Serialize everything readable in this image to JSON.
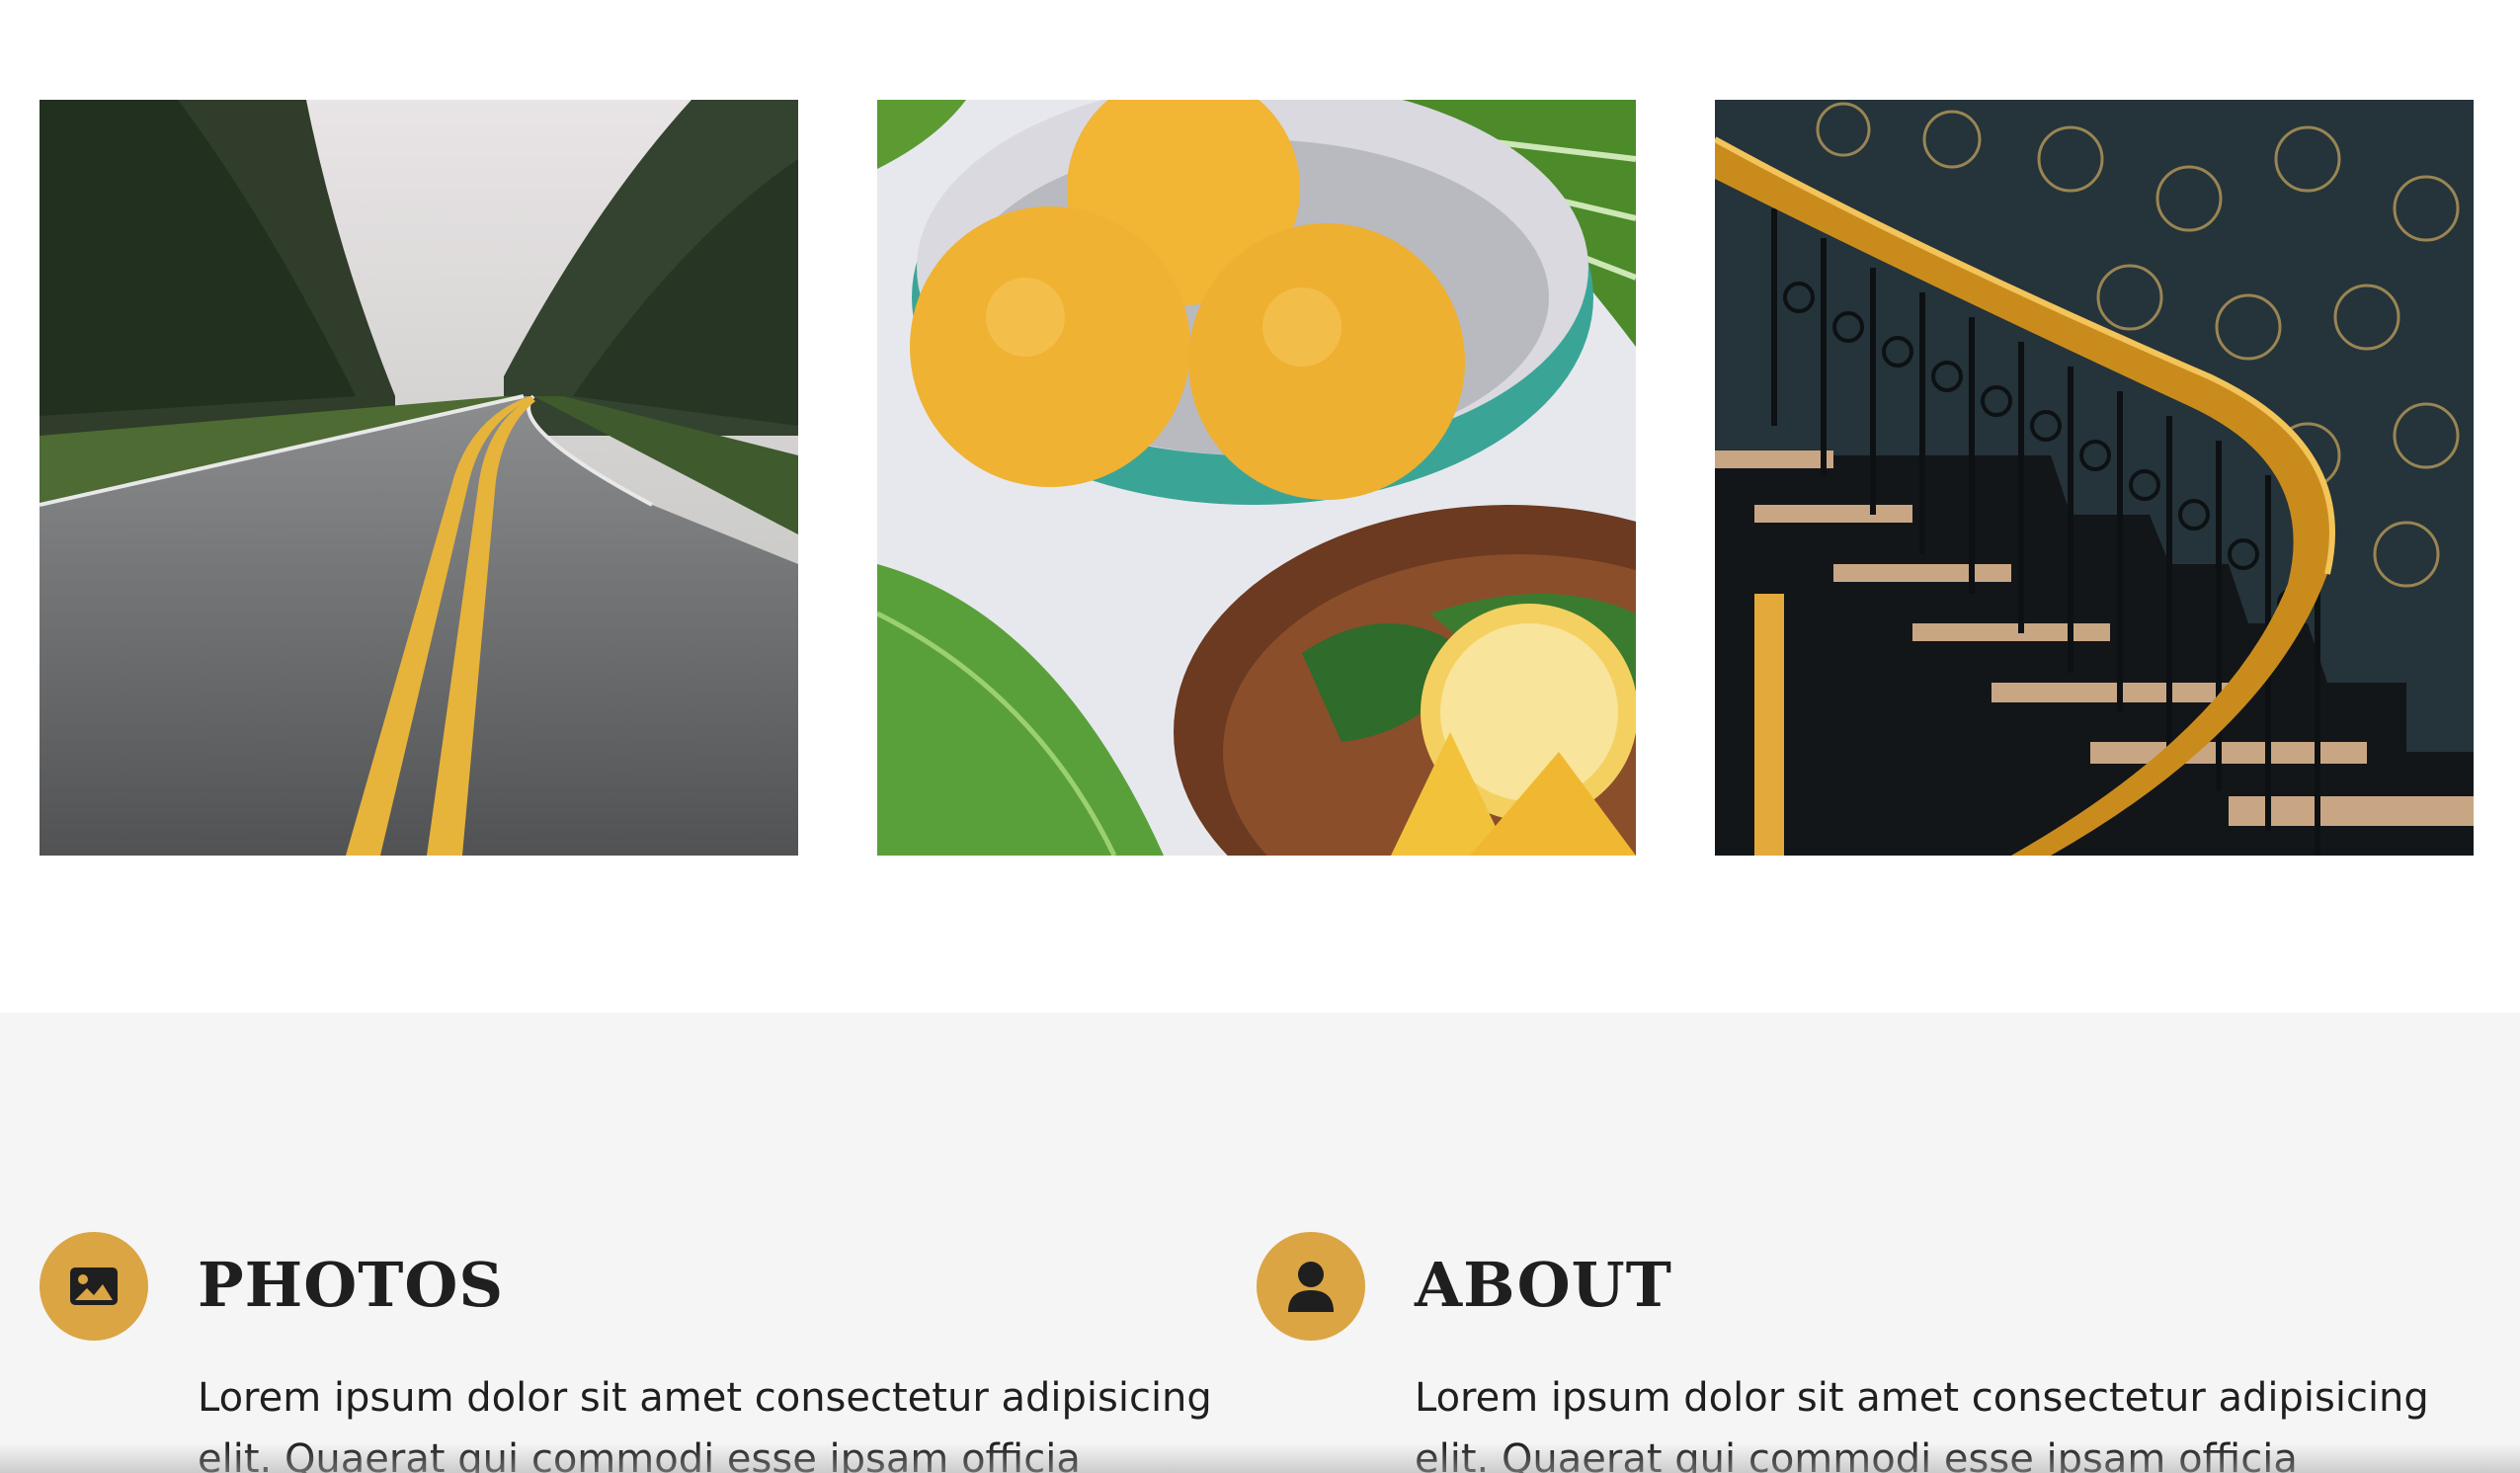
{
  "gallery": {
    "images": [
      {
        "subject": "foggy forest road with yellow center lines"
      },
      {
        "subject": "bowl of lemons with palm leaves"
      },
      {
        "subject": "staircase with gold handrail and patterned wall"
      }
    ]
  },
  "features": [
    {
      "icon": "image-icon",
      "title": "PHOTOS",
      "text": "Lorem ipsum dolor sit amet consectetur adipisicing elit. Quaerat qui commodi esse ipsam officia"
    },
    {
      "icon": "user-icon",
      "title": "ABOUT",
      "text": "Lorem ipsum dolor sit amet consectetur adipisicing elit. Quaerat qui commodi esse ipsam officia"
    }
  ],
  "colors": {
    "accent": "#dba544",
    "section_bg": "#f5f5f5",
    "text": "#1f1f1f"
  }
}
